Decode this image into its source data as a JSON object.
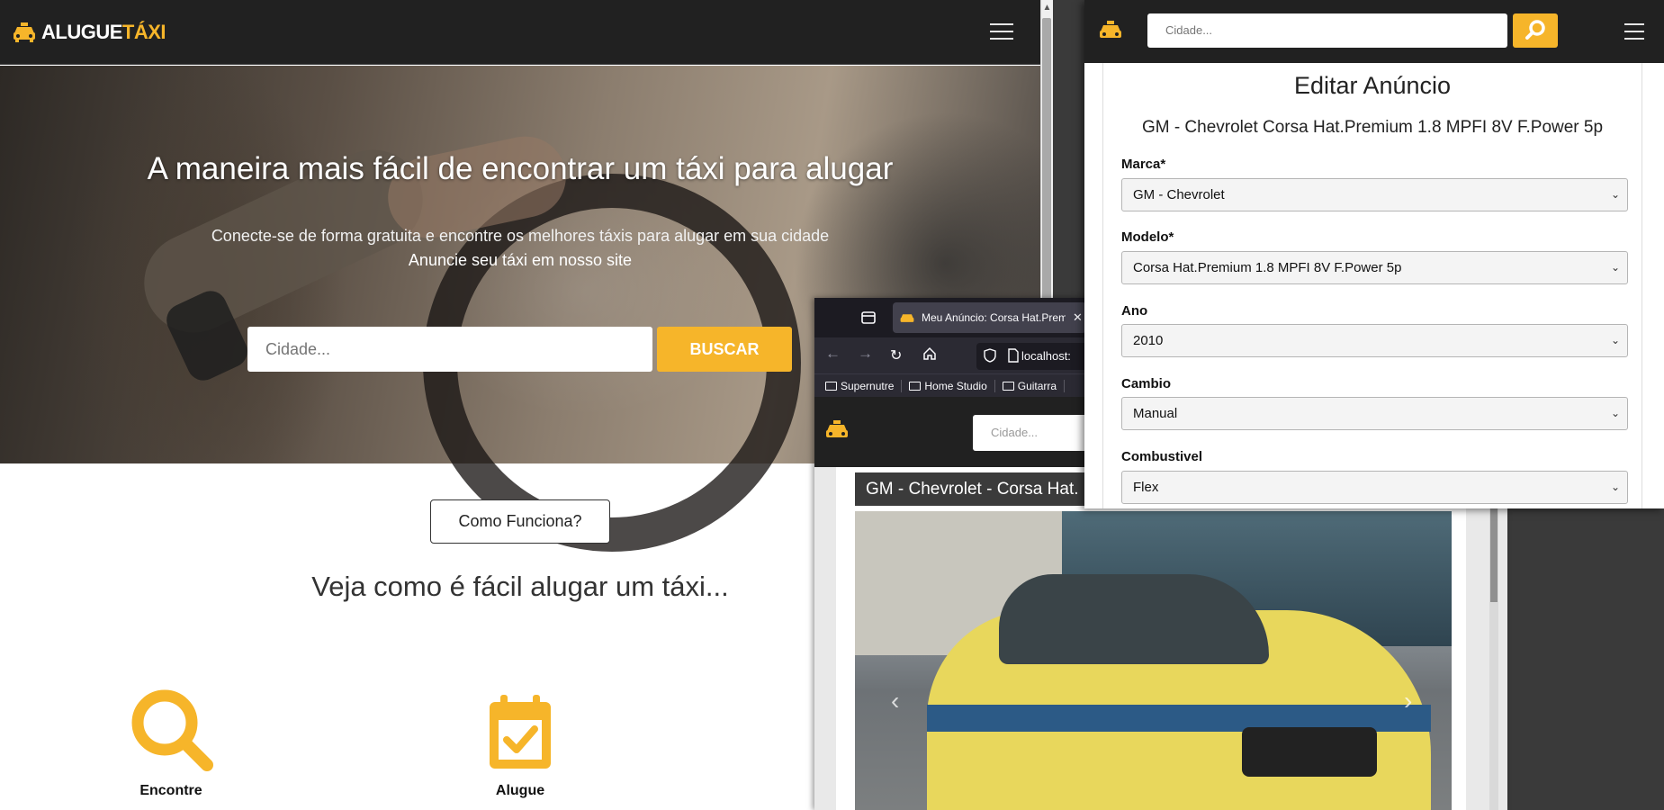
{
  "main_site": {
    "logo": {
      "part1": "ALUGUE",
      "part2": "TÁXI"
    },
    "hero": {
      "title": "A maneira mais fácil de encontrar um táxi para alugar",
      "subtitle": "Conecte-se de forma gratuita e encontre os melhores táxis para alugar em sua cidade",
      "cta_text": "Anuncie seu táxi em nosso site",
      "search_placeholder": "Cidade...",
      "search_button": "BUSCAR"
    },
    "how_button": "Como Funciona?",
    "how_heading": "Veja como é fácil alugar um táxi...",
    "features": [
      {
        "label": "Encontre",
        "icon": "search-icon"
      },
      {
        "label": "Alugue",
        "icon": "calendar-check-icon"
      }
    ]
  },
  "browser": {
    "tab_title": "Meu Anúncio: Corsa Hat.Premium",
    "url": "localhost:",
    "bookmarks": [
      "Supernutre",
      "Home Studio",
      "Guitarra"
    ],
    "site_search_placeholder": "Cidade...",
    "listing_title": "GM - Chevrolet - Corsa Hat."
  },
  "edit_panel": {
    "search_placeholder": "Cidade...",
    "title": "Editar Anúncio",
    "subtitle": "GM - Chevrolet Corsa Hat.Premium 1.8 MPFI 8V F.Power 5p",
    "fields": [
      {
        "label": "Marca*",
        "value": "GM - Chevrolet"
      },
      {
        "label": "Modelo*",
        "value": "Corsa Hat.Premium 1.8 MPFI 8V F.Power 5p"
      },
      {
        "label": "Ano",
        "value": "2010"
      },
      {
        "label": "Cambio",
        "value": "Manual"
      },
      {
        "label": "Combustivel",
        "value": "Flex"
      }
    ]
  },
  "colors": {
    "accent": "#f6b52a",
    "nav": "#212121"
  }
}
